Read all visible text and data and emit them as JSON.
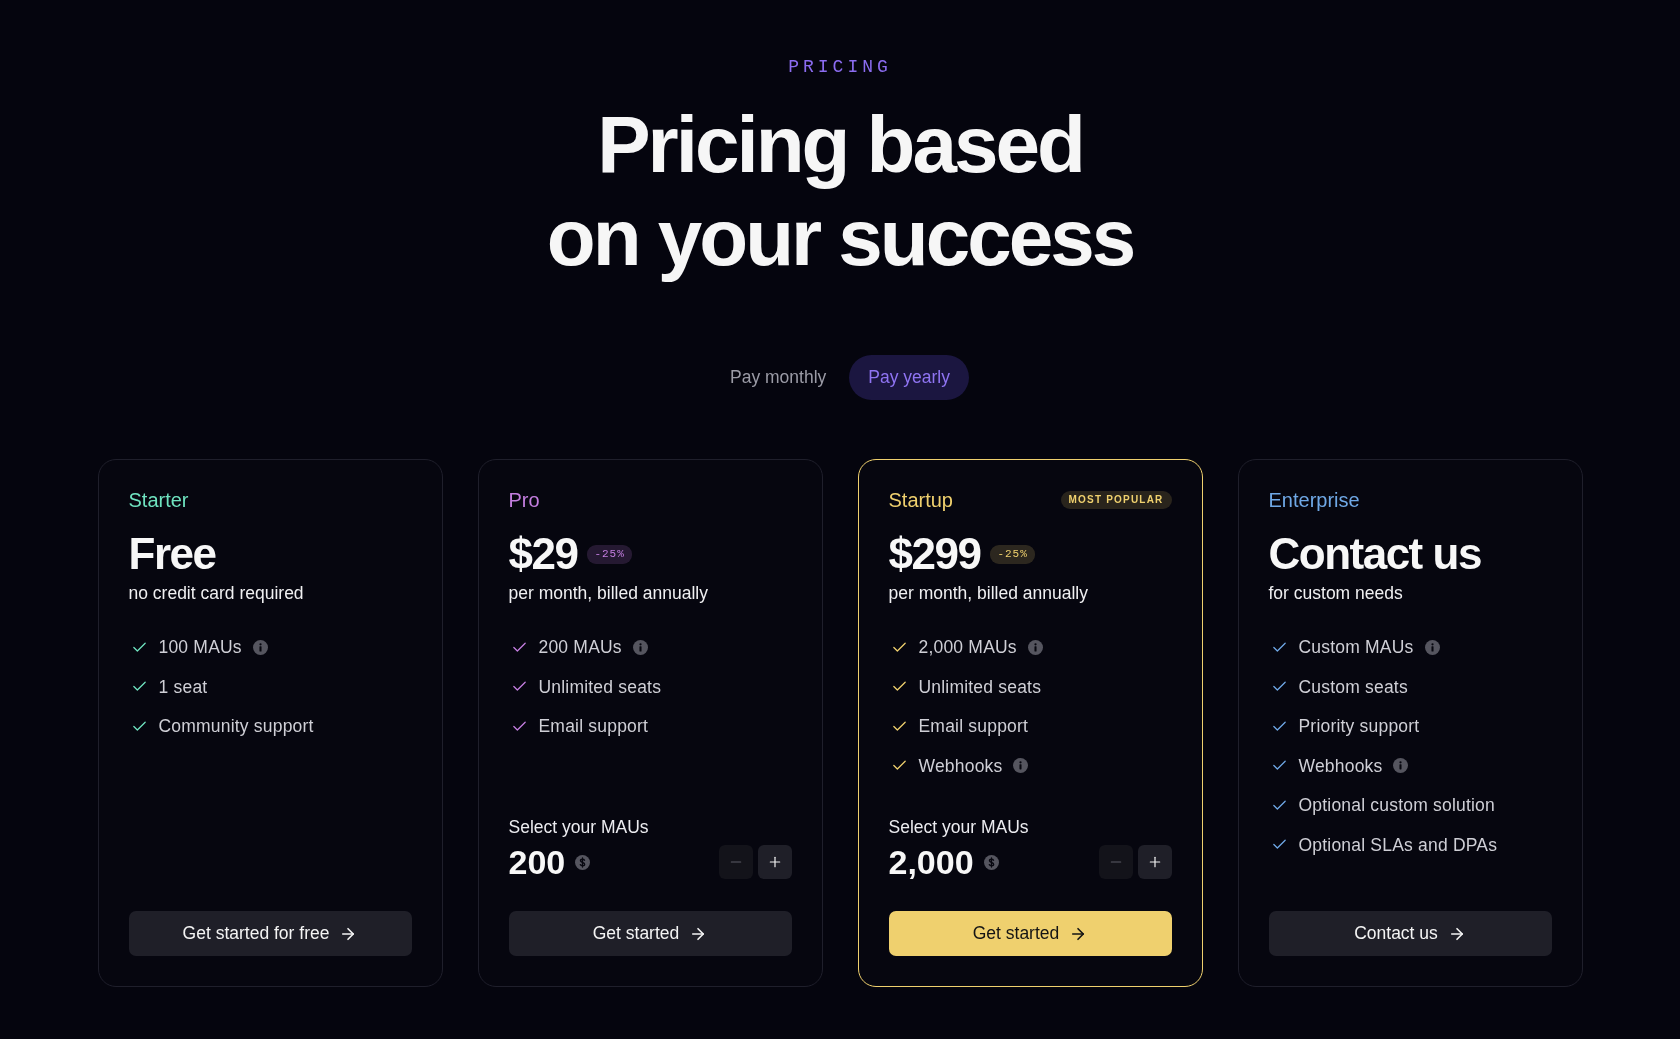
{
  "eyebrow": "PRICING",
  "heading_lines": [
    "Pricing based",
    "on your success"
  ],
  "billing_options": [
    {
      "label": "Pay monthly",
      "selected": false
    },
    {
      "label": "Pay yearly",
      "selected": true
    }
  ],
  "plans": [
    {
      "name": "Starter",
      "color": "#6fe3c0",
      "highlighted": false,
      "price": "Free",
      "price_note": "no credit card required",
      "features": [
        {
          "text": "100 MAUs",
          "info": true
        },
        {
          "text": "1 seat",
          "info": false
        },
        {
          "text": "Community support",
          "info": false
        }
      ],
      "cta": "Get started for free"
    },
    {
      "name": "Pro",
      "color": "#c47ee0",
      "highlighted": false,
      "price": "$29",
      "discount": "-25%",
      "price_note": "per month, billed annually",
      "features": [
        {
          "text": "200 MAUs",
          "info": true
        },
        {
          "text": "Unlimited seats",
          "info": false
        },
        {
          "text": "Email support",
          "info": false
        }
      ],
      "mau_selector": {
        "label": "Select your MAUs",
        "value": "200",
        "decrement_disabled": true
      },
      "cta": "Get started"
    },
    {
      "name": "Startup",
      "color": "#efd06e",
      "highlighted": true,
      "badge": "MOST POPULAR",
      "price": "$299",
      "discount": "-25%",
      "price_note": "per month, billed annually",
      "features": [
        {
          "text": "2,000 MAUs",
          "info": true
        },
        {
          "text": "Unlimited seats",
          "info": false
        },
        {
          "text": "Email support",
          "info": false
        },
        {
          "text": "Webhooks",
          "info": true
        }
      ],
      "mau_selector": {
        "label": "Select your MAUs",
        "value": "2,000",
        "decrement_disabled": true
      },
      "cta": "Get started"
    },
    {
      "name": "Enterprise",
      "color": "#6fa8e6",
      "highlighted": false,
      "price": "Contact us",
      "price_note": "for custom needs",
      "features": [
        {
          "text": "Custom MAUs",
          "info": true
        },
        {
          "text": "Custom seats",
          "info": false
        },
        {
          "text": "Priority support",
          "info": false
        },
        {
          "text": "Webhooks",
          "info": true
        },
        {
          "text": "Optional custom solution",
          "info": false
        },
        {
          "text": "Optional SLAs and DPAs",
          "info": false
        }
      ],
      "cta": "Contact us"
    }
  ]
}
